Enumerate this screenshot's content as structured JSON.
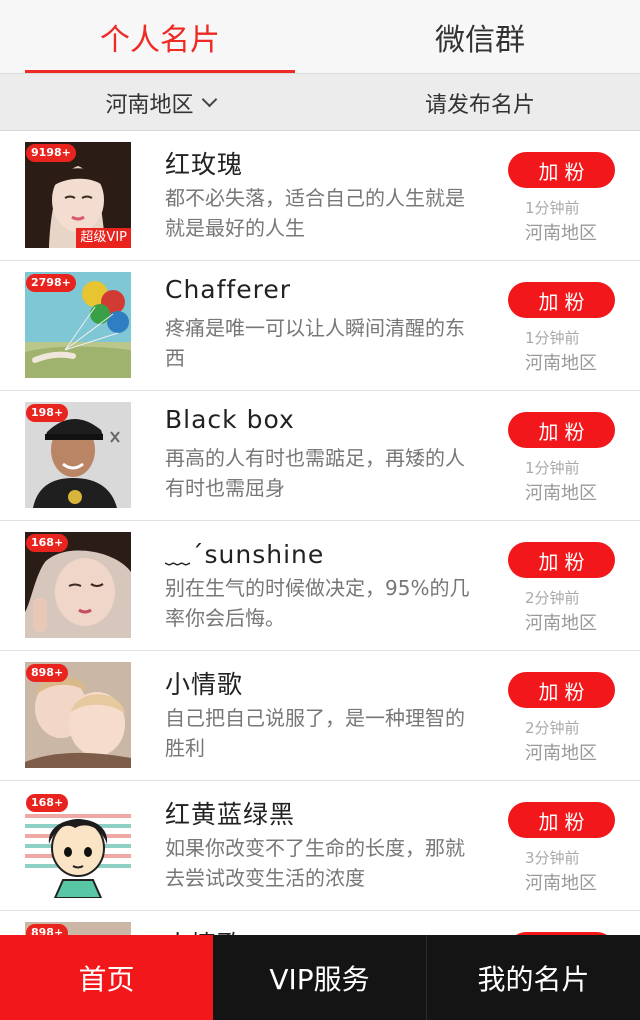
{
  "tabs": [
    "个人名片",
    "微信群"
  ],
  "filter": {
    "region": "河南地区",
    "post": "请发布名片"
  },
  "add_label": "加粉",
  "vip_label": "超级VIP",
  "cards": [
    {
      "count": "9198+",
      "name": "红玫瑰",
      "signature": "都不必失落，适合自己的人生就是就是最好的人生",
      "time": "1分钟前",
      "region": "河南地区"
    },
    {
      "count": "2798+",
      "name": "Chafferer",
      "signature": "疼痛是唯一可以让人瞬间清醒的东西",
      "time": "1分钟前",
      "region": "河南地区"
    },
    {
      "count": "198+",
      "name": "Black box",
      "signature": "再高的人有时也需踮足，再矮的人有时也需屈身",
      "time": "1分钟前",
      "region": "河南地区"
    },
    {
      "count": "168+",
      "name": "﹏´sunshine",
      "signature": "别在生气的时候做决定，95%的几率你会后悔。",
      "time": "2分钟前",
      "region": "河南地区"
    },
    {
      "count": "898+",
      "name": "小情歌",
      "signature": "自己把自己说服了，是一种理智的胜利",
      "time": "2分钟前",
      "region": "河南地区"
    },
    {
      "count": "168+",
      "name": "红黄蓝绿黑",
      "signature": "如果你改变不了生命的长度，那就去尝试改变生活的浓度",
      "time": "3分钟前",
      "region": "河南地区"
    },
    {
      "count": "898+",
      "name": "小情歌",
      "signature": "",
      "time": "",
      "region": ""
    }
  ],
  "bottom_nav": [
    "首页",
    "VIP服务",
    "我的名片"
  ]
}
